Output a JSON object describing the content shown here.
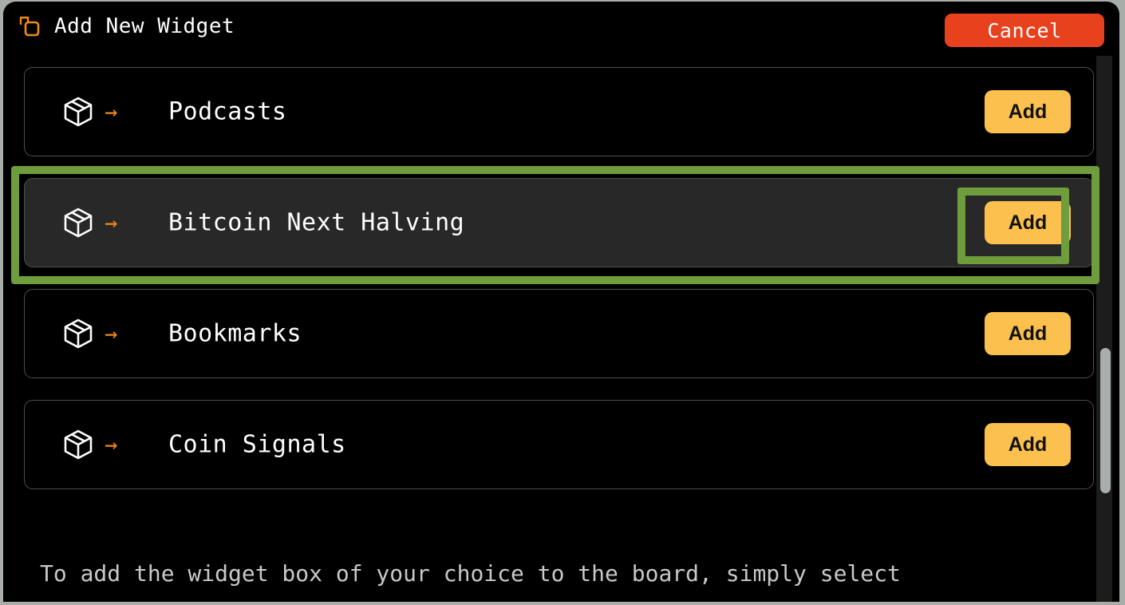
{
  "header": {
    "icon": "copy-icon",
    "title": "Add New Widget",
    "cancel_label": "Cancel"
  },
  "colors": {
    "panel_background": "#000000",
    "page_background": "#a8adaa",
    "accent_orange": "#f08a16",
    "cancel_red": "#e8411e",
    "add_yellow": "#fcc04e",
    "highlight_green": "#6f9c3c",
    "selected_row_background": "#282828",
    "row_border": "#4d4d4d",
    "description_text": "#c9c9c9"
  },
  "list": {
    "row_icon": "package-box-icon",
    "row_arrow": "→",
    "items": [
      {
        "label": "Podcasts",
        "add_label": "Add",
        "selected": false
      },
      {
        "label": "Bitcoin Next Halving",
        "add_label": "Add",
        "selected": true
      },
      {
        "label": "Bookmarks",
        "add_label": "Add",
        "selected": false
      },
      {
        "label": "Coin Signals",
        "add_label": "Add",
        "selected": false
      }
    ]
  },
  "footer": {
    "description": "To add the widget box of your choice to the board, simply select"
  },
  "scrollbar": {
    "orientation": "vertical",
    "thumb_name": "scrollbar-thumb"
  }
}
